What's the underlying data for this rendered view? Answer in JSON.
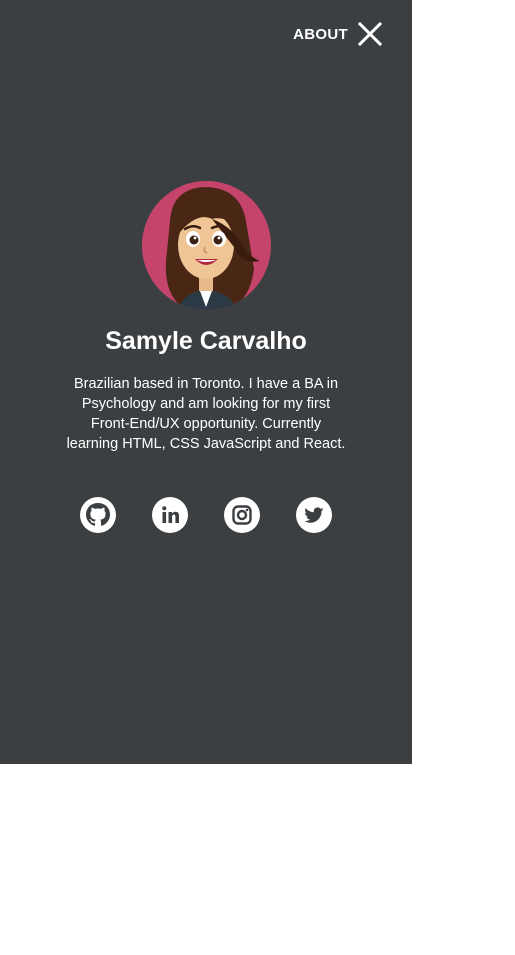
{
  "header": {
    "about_label": "ABOUT"
  },
  "icons": {
    "close": "close-icon",
    "avatar": "avatar-illustration",
    "social": [
      "github-icon",
      "linkedin-icon",
      "instagram-icon",
      "twitter-icon"
    ]
  },
  "profile": {
    "name": "Samyle Carvalho",
    "bio": "Brazilian based in Toronto. I have a BA in Psychology and am looking for my first Front-End/UX opportunity. Currently learning HTML, CSS JavaScript and React."
  },
  "colors": {
    "panel_background": "#3b3f42",
    "avatar_background": "#c5446c",
    "text": "#ffffff"
  }
}
